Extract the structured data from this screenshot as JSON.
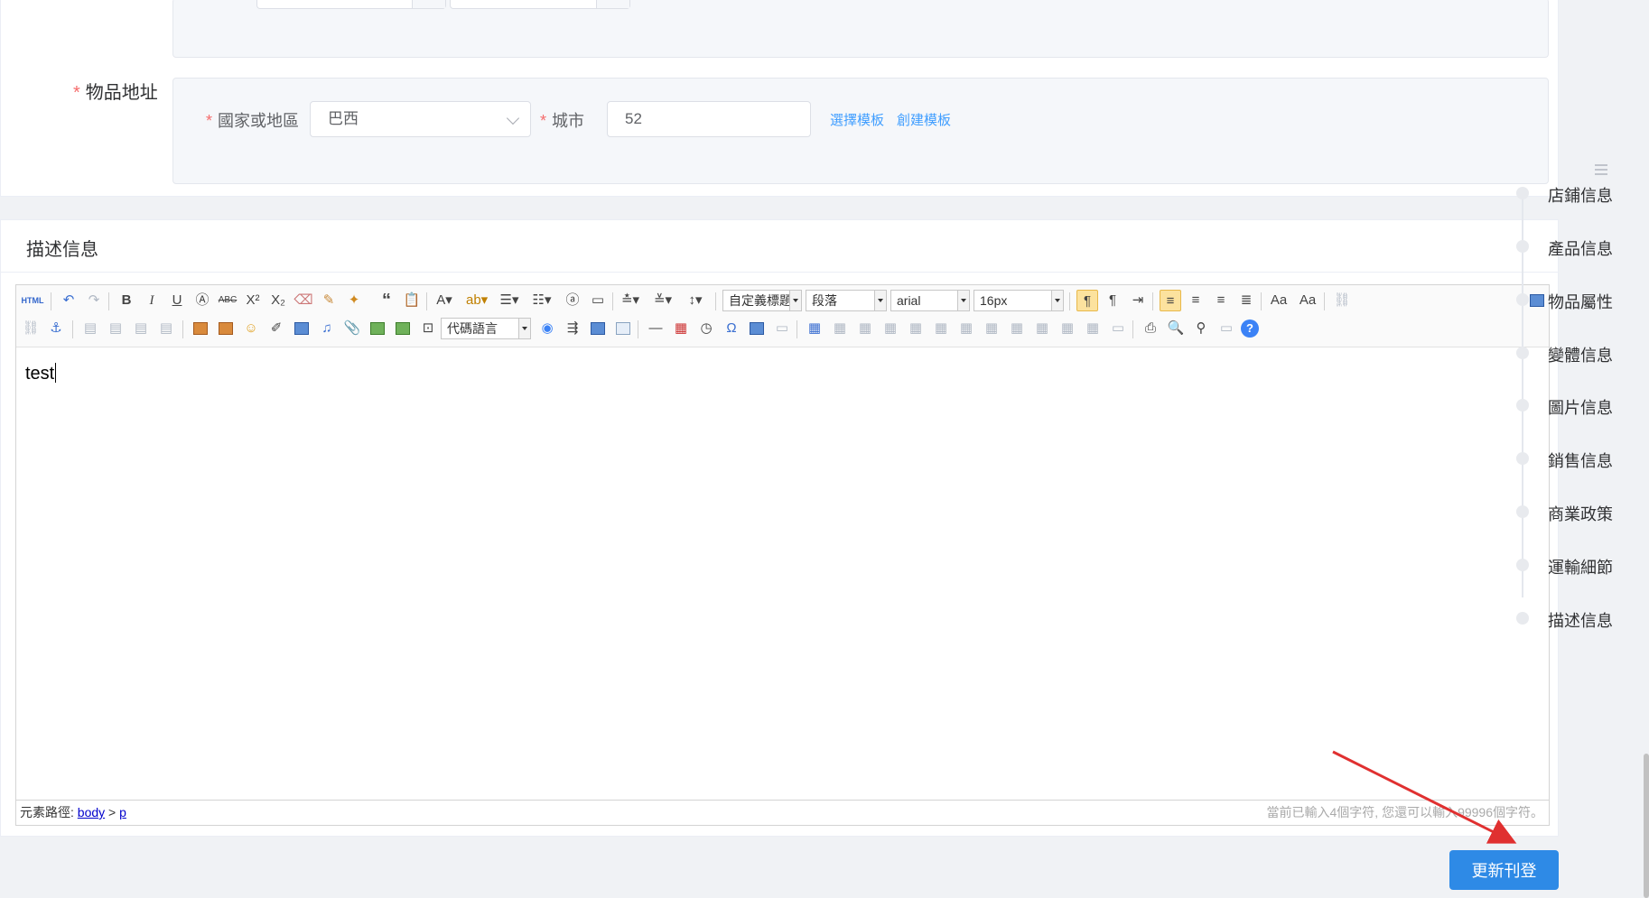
{
  "address": {
    "label": "物品地址",
    "country_label": "國家或地區",
    "country_value": "巴西",
    "city_label": "城市",
    "city_value": "52",
    "select_template": "選擇模板",
    "create_template": "創建模板"
  },
  "description": {
    "title": "描述信息",
    "editor_text": "test",
    "toolbar": {
      "html": "HTML",
      "custom_title": "自定義標題",
      "paragraph": "段落",
      "font": "arial",
      "font_size": "16px",
      "code_lang": "代碼語言"
    },
    "status": {
      "path_label": "元素路徑:",
      "path_body": "body",
      "path_sep": ">",
      "path_p": "p",
      "count_text": "當前已輸入4個字符, 您還可以輸入99996個字符。"
    }
  },
  "anchors": [
    "店鋪信息",
    "產品信息",
    "物品屬性",
    "變體信息",
    "圖片信息",
    "銷售信息",
    "商業政策",
    "運輸細節",
    "描述信息"
  ],
  "submit_label": "更新刊登",
  "colors": {
    "primary": "#2e8ae6",
    "required": "#f56c6c",
    "link": "#409eff",
    "arrow": "#e03030"
  }
}
